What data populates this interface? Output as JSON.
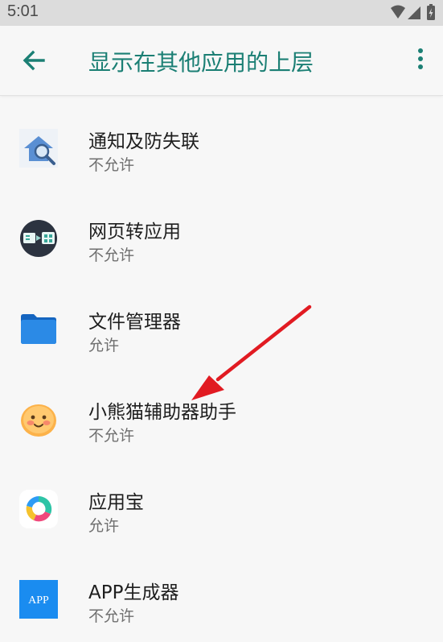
{
  "status_bar": {
    "time": "5:01",
    "icons": [
      "wifi-icon",
      "signal-icon",
      "battery-icon"
    ]
  },
  "header": {
    "title": "显示在其他应用的上层",
    "back_icon": "arrow-left-icon",
    "menu_icon": "more-vertical-icon",
    "accent_color": "#1b7f74"
  },
  "apps": [
    {
      "name": "通知及防失联",
      "status": "不允许",
      "icon": "house-search-icon"
    },
    {
      "name": "网页转应用",
      "status": "不允许",
      "icon": "web-to-app-icon"
    },
    {
      "name": "文件管理器",
      "status": "允许",
      "icon": "folder-icon"
    },
    {
      "name": "小熊猫辅助器助手",
      "status": "不允许",
      "icon": "smiley-face-icon"
    },
    {
      "name": "应用宝",
      "status": "允许",
      "icon": "yingyongbao-icon"
    },
    {
      "name": "APP生成器",
      "status": "不允许",
      "icon": "app-generator-icon",
      "icon_text": "APP"
    }
  ],
  "annotation": {
    "arrow_color": "#e11b22"
  }
}
